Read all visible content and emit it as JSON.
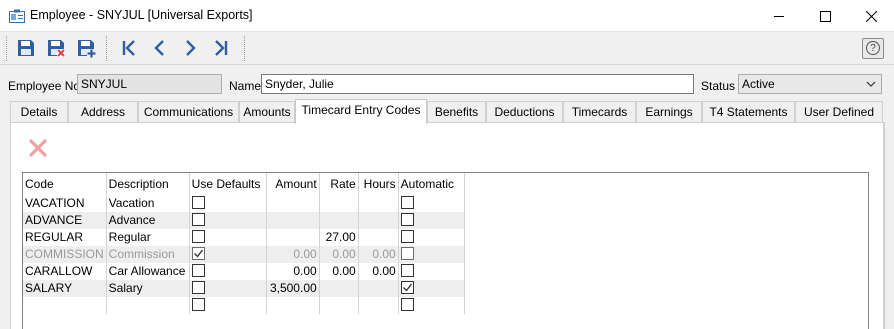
{
  "window": {
    "title": "Employee - SNYJUL [Universal Exports]"
  },
  "toolbar": {
    "buttons": [
      "save-icon",
      "save-delete-icon",
      "save-new-icon",
      "first-record-icon",
      "previous-record-icon",
      "next-record-icon",
      "last-record-icon"
    ],
    "help_label": "?"
  },
  "header": {
    "employee_no_label": "Employee No",
    "employee_no_value": "SNYJUL",
    "name_label": "Name",
    "name_value": "Snyder, Julie",
    "status_label": "Status",
    "status_value": "Active"
  },
  "tabs": [
    "Details",
    "Address",
    "Communications",
    "Amounts",
    "Timecard Entry Codes",
    "Benefits",
    "Deductions",
    "Timecards",
    "Earnings",
    "T4 Statements",
    "User Defined"
  ],
  "active_tab": "Timecard Entry Codes",
  "grid": {
    "columns": [
      "Code",
      "Description",
      "Use Defaults",
      "Amount",
      "Rate",
      "Hours",
      "Automatic"
    ],
    "rows": [
      {
        "code": "VACATION",
        "description": "Vacation",
        "use_defaults": false,
        "amount": "",
        "rate": "",
        "hours": "",
        "automatic": false,
        "disabled": false
      },
      {
        "code": "ADVANCE",
        "description": "Advance",
        "use_defaults": false,
        "amount": "",
        "rate": "",
        "hours": "",
        "automatic": false,
        "disabled": false
      },
      {
        "code": "REGULAR",
        "description": "Regular",
        "use_defaults": false,
        "amount": "",
        "rate": "27.00",
        "hours": "",
        "automatic": false,
        "disabled": false
      },
      {
        "code": "COMMISSION",
        "description": "Commission",
        "use_defaults": true,
        "amount": "0.00",
        "rate": "0.00",
        "hours": "0.00",
        "automatic": false,
        "disabled": true
      },
      {
        "code": "CARALLOW",
        "description": "Car Allowance",
        "use_defaults": false,
        "amount": "0.00",
        "rate": "0.00",
        "hours": "0.00",
        "automatic": false,
        "disabled": false
      },
      {
        "code": "SALARY",
        "description": "Salary",
        "use_defaults": false,
        "amount": "3,500.00",
        "rate": "",
        "hours": "",
        "automatic": true,
        "disabled": false
      },
      {
        "code": "",
        "description": "",
        "use_defaults": false,
        "amount": "",
        "rate": "",
        "hours": "",
        "automatic": false,
        "disabled": false
      }
    ]
  },
  "colors": {
    "delete_icon": "#f0a0a0",
    "toolbar_icon": "#2f5fa0",
    "alt_row": "#eeeeee",
    "disabled_text": "#9a9a9a"
  }
}
